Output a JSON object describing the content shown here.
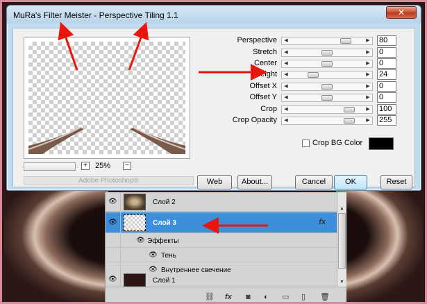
{
  "dialog": {
    "title": "MuRa's Filter Meister - Perspective Tiling 1.1",
    "close_glyph": "✕",
    "zoom": {
      "plus": "+",
      "minus": "−",
      "level": "25%"
    },
    "host_label": "Adobe Photoshop®",
    "sliders": [
      {
        "label": "Perspective",
        "value": "80",
        "level": 0.8
      },
      {
        "label": "Stretch",
        "value": "0",
        "level": 0.5
      },
      {
        "label": "Center",
        "value": "0",
        "level": 0.5
      },
      {
        "label": "Height",
        "value": "24",
        "level": 0.28
      },
      {
        "label": "Offset X",
        "value": "0",
        "level": 0.5
      },
      {
        "label": "Offset Y",
        "value": "0",
        "level": 0.5
      },
      {
        "label": "Crop",
        "value": "100",
        "level": 0.86
      },
      {
        "label": "Crop Opacity",
        "value": "255",
        "level": 0.86
      }
    ],
    "crop_bg": {
      "label": "Crop BG Color",
      "checked": false,
      "color": "#000000"
    },
    "buttons": {
      "web": "Web",
      "about": "About...",
      "cancel": "Cancel",
      "ok": "OK",
      "reset": "Reset"
    }
  },
  "layers": {
    "rows": [
      {
        "name": "Слой 2"
      },
      {
        "name": "Слой 3",
        "fx": "fx"
      }
    ],
    "effects_label": "Эффекты",
    "effects": [
      "Тень",
      "Внутреннее свечение"
    ],
    "bottom_layer": "Слой 1",
    "toolbar": [
      "⛓",
      "fx",
      "◙",
      "◐",
      "▭",
      "▯",
      "🗑"
    ]
  },
  "colors": {
    "annotation": "#e8160c",
    "selection": "#3d8fdc"
  }
}
